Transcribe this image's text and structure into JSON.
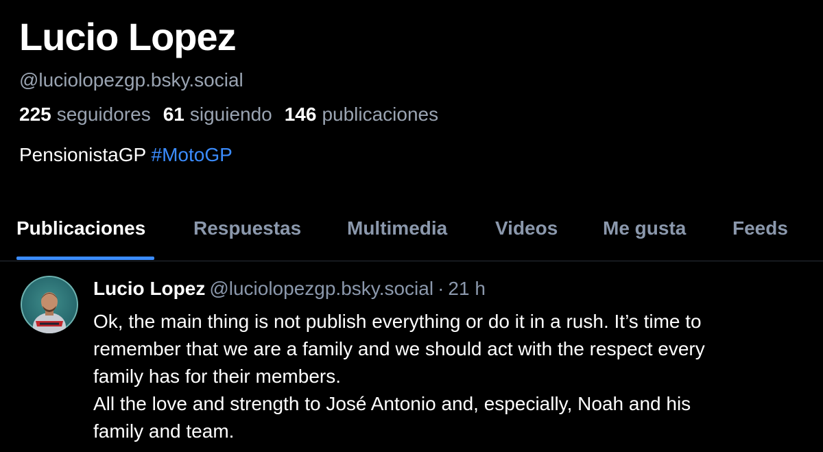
{
  "profile": {
    "display_name": "Lucio Lopez",
    "handle": "@luciolopezgp.bsky.social",
    "stats": {
      "followers_count": "225",
      "followers_label": "seguidores",
      "following_count": "61",
      "following_label": "siguiendo",
      "posts_count": "146",
      "posts_label": "publicaciones"
    },
    "bio": {
      "text": "PensionistaGP",
      "hashtag": "#MotoGP"
    }
  },
  "tabs": [
    {
      "label": "Publicaciones",
      "active": true
    },
    {
      "label": "Respuestas",
      "active": false
    },
    {
      "label": "Multimedia",
      "active": false
    },
    {
      "label": "Videos",
      "active": false
    },
    {
      "label": "Me gusta",
      "active": false
    },
    {
      "label": "Feeds",
      "active": false
    }
  ],
  "post": {
    "author": "Lucio Lopez",
    "handle": "@luciolopezgp.bsky.social",
    "separator": "·",
    "time": "21 h",
    "lines": [
      "Ok, the main thing is not publish everything or do it in a rush. It’s time to",
      "remember that we are a family and we should act with the respect every",
      "family has for their members.",
      "All the love and strength to José Antonio and, especially, Noah and his",
      "family and team."
    ]
  },
  "colors": {
    "background": "#000000",
    "text": "#ffffff",
    "muted": "#9aa4b2",
    "accent": "#3b8cff",
    "divider": "#2a3038"
  }
}
